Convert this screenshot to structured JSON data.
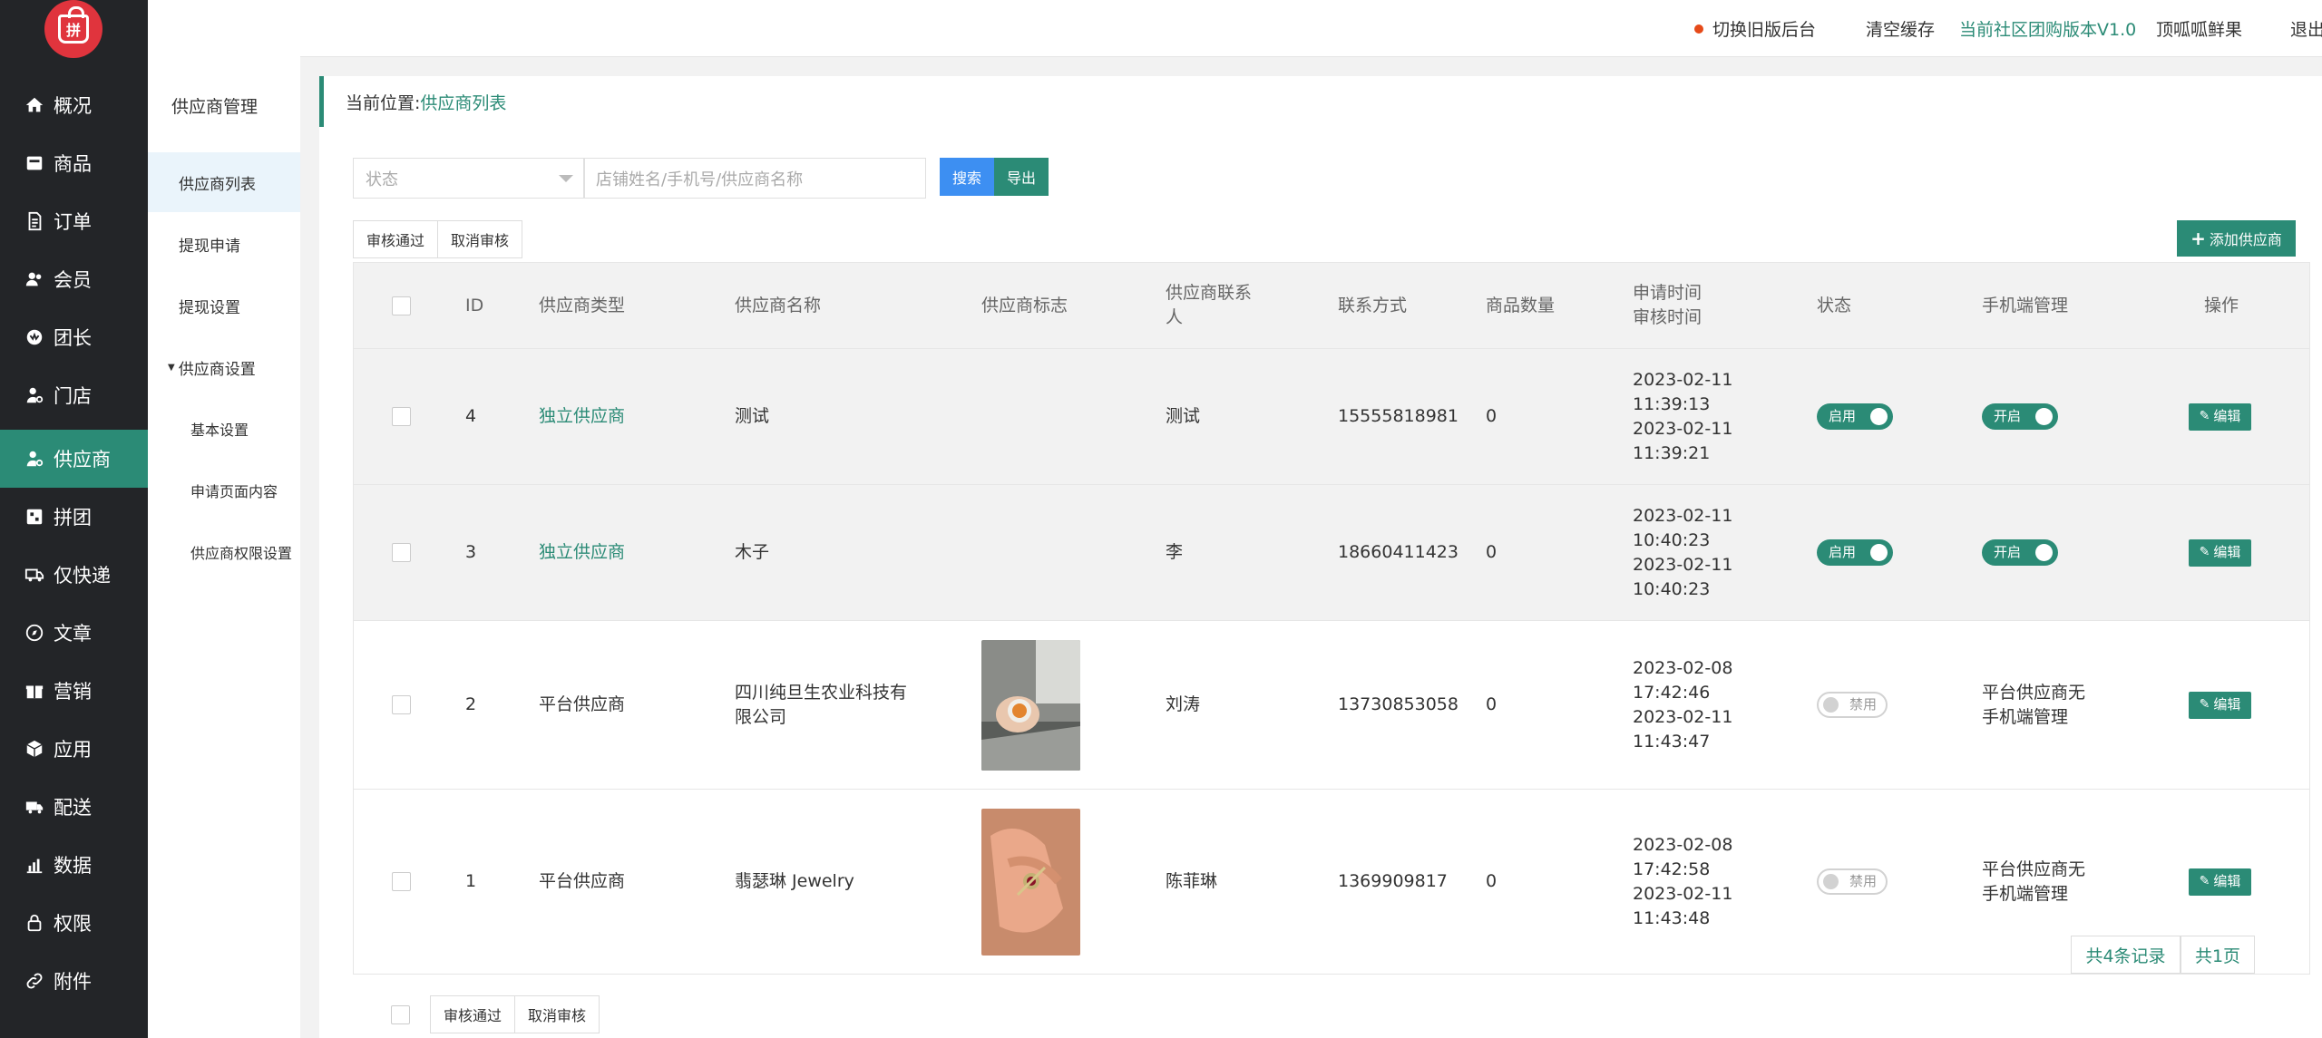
{
  "nav": {
    "items": [
      {
        "label": "概况",
        "icon": "home-icon"
      },
      {
        "label": "商品",
        "icon": "goods-icon"
      },
      {
        "label": "订单",
        "icon": "order-icon"
      },
      {
        "label": "会员",
        "icon": "members-icon"
      },
      {
        "label": "团长",
        "icon": "leader-icon"
      },
      {
        "label": "门店",
        "icon": "store-icon"
      },
      {
        "label": "供应商",
        "icon": "supplier-icon",
        "active": true
      },
      {
        "label": "拼团",
        "icon": "groupbuy-icon"
      },
      {
        "label": "仅快递",
        "icon": "delivery-truck-icon"
      },
      {
        "label": "文章",
        "icon": "compass-icon"
      },
      {
        "label": "营销",
        "icon": "gift-icon"
      },
      {
        "label": "应用",
        "icon": "cube-icon"
      },
      {
        "label": "配送",
        "icon": "truck-icon"
      },
      {
        "label": "数据",
        "icon": "chart-icon"
      },
      {
        "label": "权限",
        "icon": "lock-icon"
      },
      {
        "label": "附件",
        "icon": "link-icon"
      }
    ],
    "logo_text": "拼"
  },
  "subnav": {
    "title": "供应商管理",
    "items": [
      {
        "label": "供应商列表",
        "active": true
      },
      {
        "label": "提现申请"
      },
      {
        "label": "提现设置"
      },
      {
        "label": "供应商设置",
        "group": true
      },
      {
        "label": "基本设置",
        "child": true
      },
      {
        "label": "申请页面内容",
        "child": true
      },
      {
        "label": "供应商权限设置",
        "child": true
      }
    ]
  },
  "topbar": {
    "switch_old": "切换旧版后台",
    "clear_cache": "清空缓存",
    "version": "当前社区团购版本V1.0",
    "shop_name": "顶呱呱鲜果",
    "logout": "退出"
  },
  "breadcrumb": {
    "prefix": "当前位置:",
    "current": "供应商列表"
  },
  "filters": {
    "status_placeholder": "状态",
    "keyword_placeholder": "店铺姓名/手机号/供应商名称",
    "search": "搜索",
    "export": "导出"
  },
  "actions": {
    "approve": "审核通过",
    "cancel_approve": "取消审核",
    "add": "添加供应商"
  },
  "table": {
    "headers": {
      "id": "ID",
      "type": "供应商类型",
      "name": "供应商名称",
      "logo": "供应商标志",
      "contact": "供应商联系\n人",
      "phone": "联系方式",
      "goods": "商品数量",
      "time": "申请时间\n审核时间",
      "status": "状态",
      "mobile": "手机端管理",
      "op": "操作"
    },
    "rows": [
      {
        "id": "4",
        "type": "独立供应商",
        "name": "测试",
        "contact": "测试",
        "phone": "15555818981",
        "goods": "0",
        "apply_date": "2023-02-11",
        "apply_time": "11:39:13",
        "audit_date": "2023-02-11",
        "audit_time": "11:39:21",
        "status": "启用",
        "mobile": "开启",
        "edit": "编辑"
      },
      {
        "id": "3",
        "type": "独立供应商",
        "name": "木子",
        "contact": "李",
        "phone": "18660411423",
        "goods": "0",
        "apply_date": "2023-02-11",
        "apply_time": "10:40:23",
        "audit_date": "2023-02-11",
        "audit_time": "10:40:23",
        "status": "启用",
        "mobile": "开启",
        "edit": "编辑"
      },
      {
        "id": "2",
        "type": "平台供应商",
        "name": "四川纯旦生农业科技有\n限公司",
        "contact": "刘涛",
        "phone": "13730853058",
        "goods": "0",
        "apply_date": "2023-02-08",
        "apply_time": "17:42:46",
        "audit_date": "2023-02-11",
        "audit_time": "11:43:47",
        "status": "禁用",
        "mobile": "平台供应商无\n手机端管理",
        "edit": "编辑"
      },
      {
        "id": "1",
        "type": "平台供应商",
        "name": "翡瑟琳 Jewelry",
        "contact": "陈菲琳",
        "phone": "1369909817",
        "goods": "0",
        "apply_date": "2023-02-08",
        "apply_time": "17:42:58",
        "audit_date": "2023-02-11",
        "audit_time": "11:43:48",
        "status": "禁用",
        "mobile": "平台供应商无\n手机端管理",
        "edit": "编辑"
      }
    ]
  },
  "pager": {
    "total_records": "共4条记录",
    "total_pages": "共1页"
  },
  "colors": {
    "accent": "#2b8b76",
    "sidebar": "#232528",
    "search": "#3d8ff2",
    "logo": "#e0343d"
  }
}
